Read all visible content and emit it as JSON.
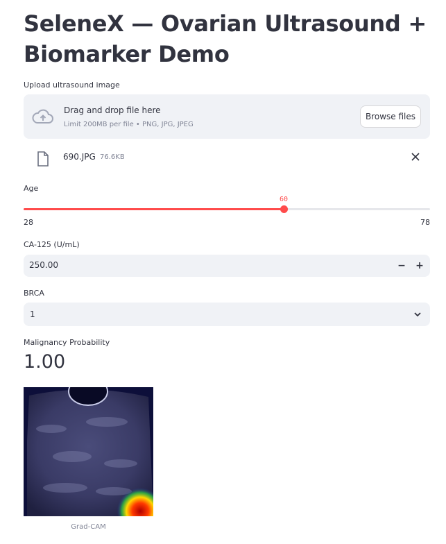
{
  "page": {
    "title": "SeleneX — Ovarian Ultrasound + Biomarker Demo"
  },
  "uploader": {
    "label": "Upload ultrasound image",
    "dropzone_title": "Drag and drop file here",
    "dropzone_subtitle": "Limit 200MB per file • PNG, JPG, JPEG",
    "browse_label": "Browse files",
    "file_name": "690.JPG",
    "file_size": "76.6KB"
  },
  "age": {
    "label": "Age",
    "min": 28,
    "max": 78,
    "value": 60
  },
  "ca125": {
    "label": "CA-125 (U/mL)",
    "value": "250.00",
    "minus": "−",
    "plus": "+"
  },
  "brca": {
    "label": "BRCA",
    "selected": "1"
  },
  "metric": {
    "label": "Malignancy Probability",
    "value": "1.00"
  },
  "image": {
    "caption": "Grad-CAM"
  },
  "colors": {
    "accent": "#ff4b4b",
    "input_bg": "#f0f2f6",
    "text": "#31333f",
    "muted": "#808495"
  }
}
